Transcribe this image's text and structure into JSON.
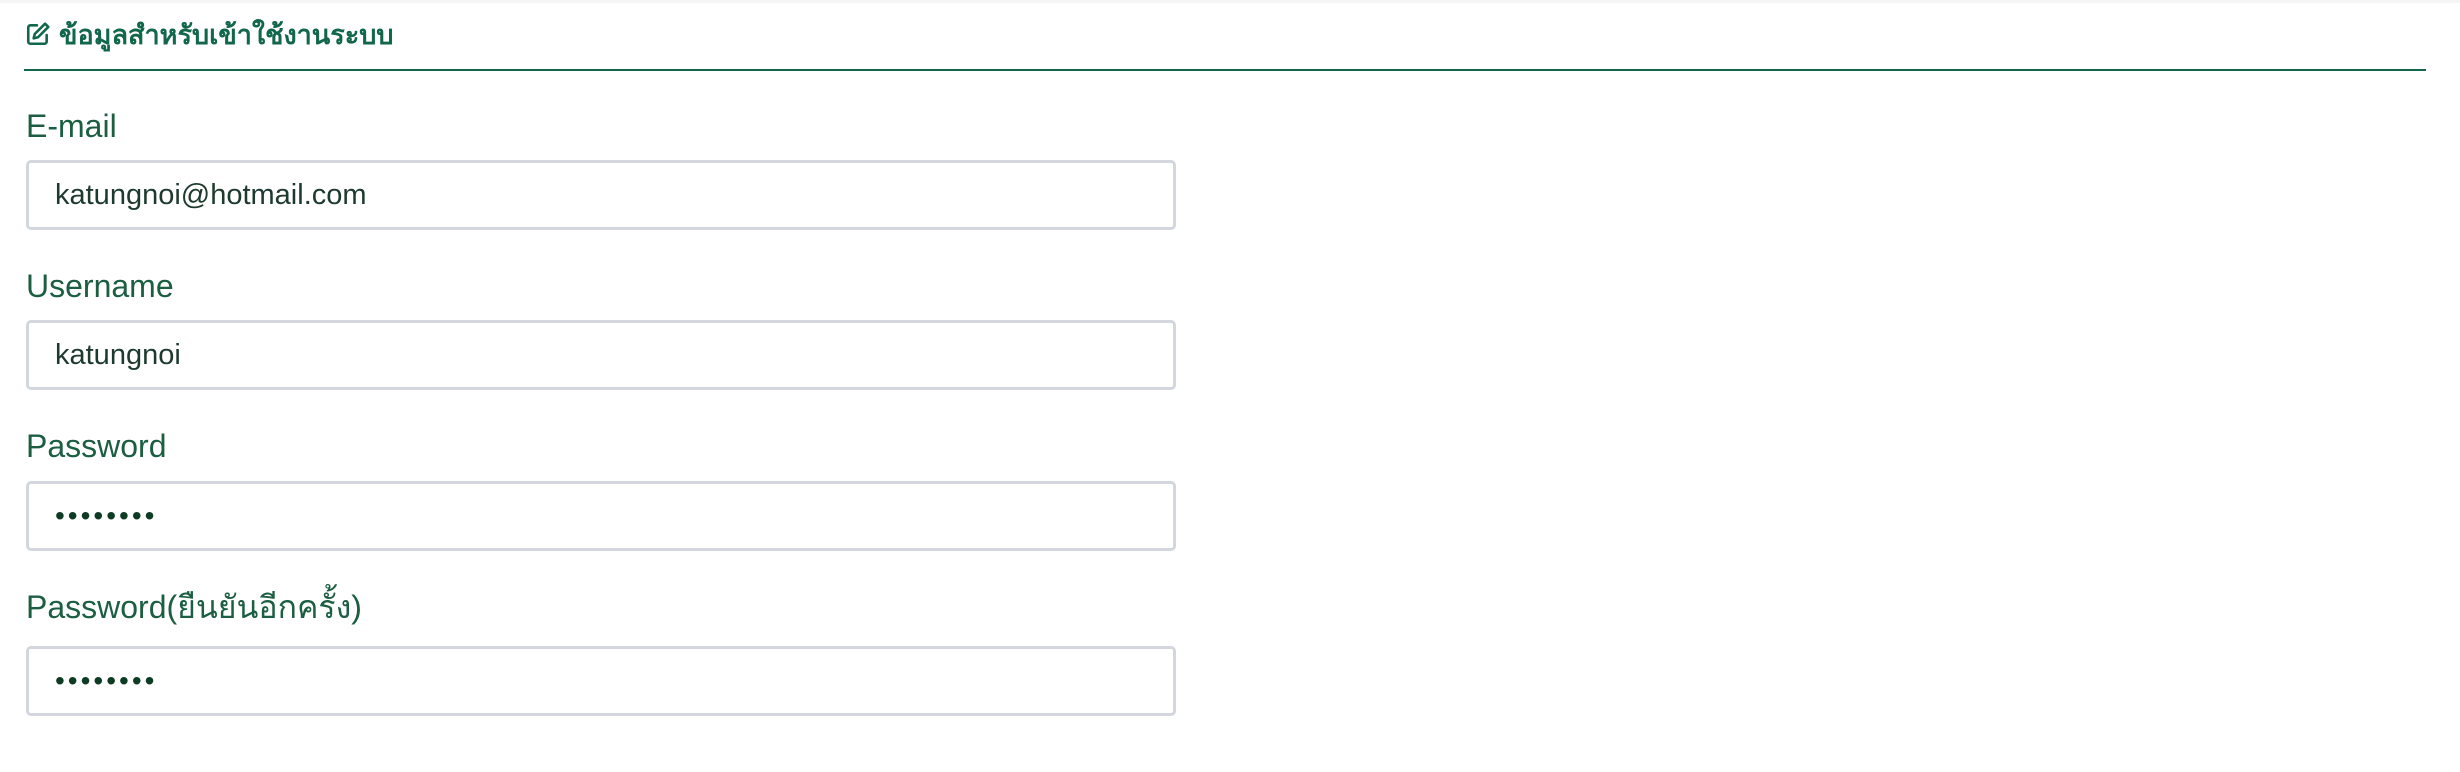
{
  "section": {
    "icon": "edit-icon",
    "title": "ข้อมูลสำหรับเข้าใช้งานระบบ"
  },
  "fields": {
    "email": {
      "label": "E-mail",
      "value": "katungnoi@hotmail.com"
    },
    "username": {
      "label": "Username",
      "value": "katungnoi"
    },
    "password": {
      "label": "Password",
      "masked_value": "••••••••"
    },
    "password_confirm": {
      "label": "Password(ยืนยันอีกครั้ง)",
      "masked_value": "••••••••"
    }
  },
  "colors": {
    "accent": "#12674a",
    "label": "#1b5e42",
    "input_border": "#d3d7dd"
  }
}
